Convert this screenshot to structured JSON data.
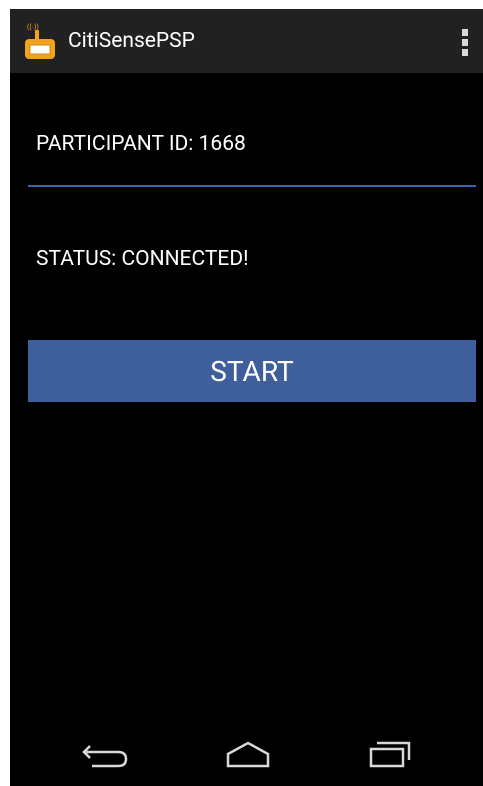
{
  "app": {
    "title": "CitiSensePSP",
    "icon": "app-icon-orange-sensor",
    "overflow_icon": "overflow-menu-icon"
  },
  "main": {
    "participant_id_label": "PARTICIPANT ID: 1668",
    "status_label": "STATUS: CONNECTED!",
    "start_button_label": "START"
  },
  "nav_bar": {
    "back_icon": "back-icon",
    "home_icon": "home-icon",
    "recents_icon": "recents-icon"
  },
  "colors": {
    "background": "#000000",
    "action_bar": "#212121",
    "accent_underline": "#3c64ad",
    "button": "#3f5e9c",
    "icon_orange": "#f2a21d",
    "text": "#ffffff"
  }
}
